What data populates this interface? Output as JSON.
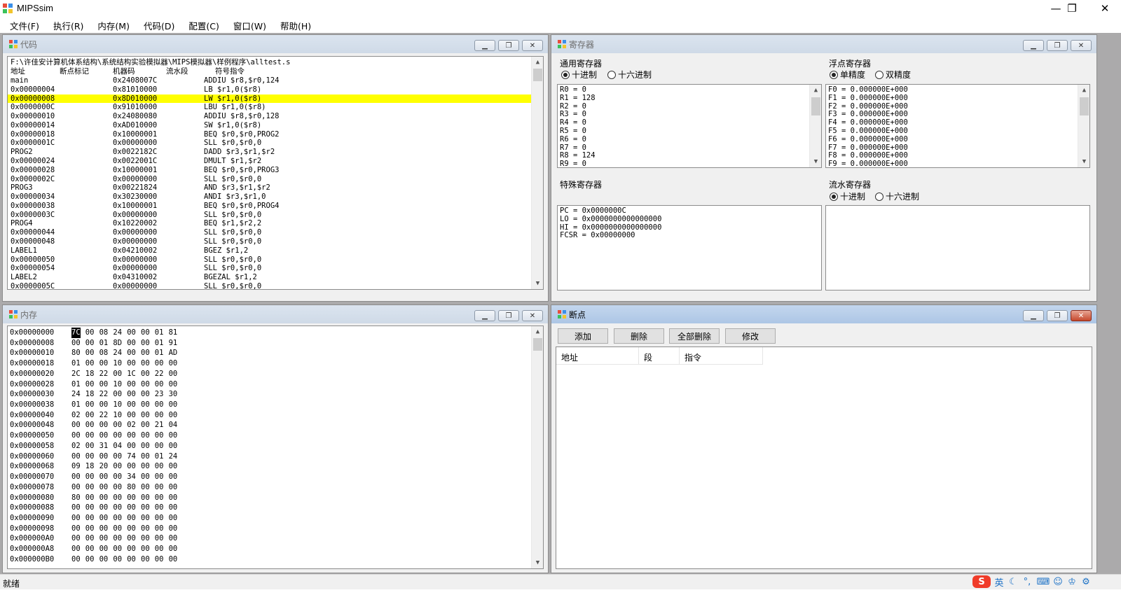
{
  "app": {
    "title": "MIPSsim",
    "min": "—",
    "max": "❐",
    "close": "✕"
  },
  "menu": [
    "文件(F)",
    "执行(R)",
    "内存(M)",
    "代码(D)",
    "配置(C)",
    "窗口(W)",
    "帮助(H)"
  ],
  "code_panel": {
    "title": "代码",
    "path": "F:\\许佳安计算机体系结构\\系统结构实验模拟器\\MIPS模拟器\\样例程序\\alltest.s",
    "headers": {
      "addr": "地址",
      "bp": "断点标记",
      "code": "机器码",
      "stage": "流水段",
      "inst": "符号指令"
    },
    "highlight_color": "#ffff00",
    "rows": [
      {
        "addr": "main",
        "code": "0x2408007C",
        "inst": "ADDIU $r8,$r0,124"
      },
      {
        "addr": "0x00000004",
        "code": "0x81010000",
        "inst": "LB $r1,0($r8)"
      },
      {
        "addr": "0x00000008",
        "code": "0x8D010000",
        "inst": "LW $r1,0($r8)",
        "highlight": true
      },
      {
        "addr": "0x0000000C",
        "code": "0x91010000",
        "inst": "LBU $r1,0($r8)"
      },
      {
        "addr": "0x00000010",
        "code": "0x24080080",
        "inst": "ADDIU $r8,$r0,128"
      },
      {
        "addr": "0x00000014",
        "code": "0xAD010000",
        "inst": "SW $r1,0($r8)"
      },
      {
        "addr": "0x00000018",
        "code": "0x10000001",
        "inst": "BEQ $r0,$r0,PROG2"
      },
      {
        "addr": "0x0000001C",
        "code": "0x00000000",
        "inst": "SLL $r0,$r0,0"
      },
      {
        "addr": "PROG2",
        "code": "0x0022182C",
        "inst": "DADD $r3,$r1,$r2"
      },
      {
        "addr": "0x00000024",
        "code": "0x0022001C",
        "inst": "DMULT $r1,$r2"
      },
      {
        "addr": "0x00000028",
        "code": "0x10000001",
        "inst": "BEQ $r0,$r0,PROG3"
      },
      {
        "addr": "0x0000002C",
        "code": "0x00000000",
        "inst": "SLL $r0,$r0,0"
      },
      {
        "addr": "PROG3",
        "code": "0x00221824",
        "inst": "AND $r3,$r1,$r2"
      },
      {
        "addr": "0x00000034",
        "code": "0x30230000",
        "inst": "ANDI $r3,$r1,0"
      },
      {
        "addr": "0x00000038",
        "code": "0x10000001",
        "inst": "BEQ $r0,$r0,PROG4"
      },
      {
        "addr": "0x0000003C",
        "code": "0x00000000",
        "inst": "SLL $r0,$r0,0"
      },
      {
        "addr": "PROG4",
        "code": "0x10220002",
        "inst": "BEQ $r1,$r2,2"
      },
      {
        "addr": "0x00000044",
        "code": "0x00000000",
        "inst": "SLL $r0,$r0,0"
      },
      {
        "addr": "0x00000048",
        "code": "0x00000000",
        "inst": "SLL $r0,$r0,0"
      },
      {
        "addr": "LABEL1",
        "code": "0x04210002",
        "inst": "BGEZ $r1,2"
      },
      {
        "addr": "0x00000050",
        "code": "0x00000000",
        "inst": "SLL $r0,$r0,0"
      },
      {
        "addr": "0x00000054",
        "code": "0x00000000",
        "inst": "SLL $r0,$r0,0"
      },
      {
        "addr": "LABEL2",
        "code": "0x04310002",
        "inst": "BGEZAL $r1,2"
      },
      {
        "addr": "0x0000005C",
        "code": "0x00000000",
        "inst": "SLL $r0,$r0,0"
      }
    ]
  },
  "registers_panel": {
    "title": "寄存器",
    "general": {
      "label": "通用寄存器",
      "radio_dec": "十进制",
      "radio_hex": "十六进制",
      "values": [
        "R0 = 0",
        "R1 = 128",
        "R2 = 0",
        "R3 = 0",
        "R4 = 0",
        "R5 = 0",
        "R6 = 0",
        "R7 = 0",
        "R8 = 124",
        "R9 = 0"
      ]
    },
    "float": {
      "label": "浮点寄存器",
      "radio_single": "单精度",
      "radio_double": "双精度",
      "values": [
        "F0 = 0.000000E+000",
        "F1 = 0.000000E+000",
        "F2 = 0.000000E+000",
        "F3 = 0.000000E+000",
        "F4 = 0.000000E+000",
        "F5 = 0.000000E+000",
        "F6 = 0.000000E+000",
        "F7 = 0.000000E+000",
        "F8 = 0.000000E+000",
        "F9 = 0.000000E+000"
      ]
    },
    "special": {
      "label": "特殊寄存器",
      "values": [
        "PC = 0x0000000C",
        "LO = 0x0000000000000000",
        "HI = 0x0000000000000000",
        "FCSR = 0x00000000"
      ]
    },
    "pipeline": {
      "label": "流水寄存器",
      "radio_dec": "十进制",
      "radio_hex": "十六进制"
    }
  },
  "memory_panel": {
    "title": "内存",
    "rows": [
      {
        "addr": "0x00000000",
        "bytes": [
          "7C",
          "00",
          "08",
          "24",
          "00",
          "00",
          "01",
          "81"
        ]
      },
      {
        "addr": "0x00000008",
        "bytes": [
          "00",
          "00",
          "01",
          "8D",
          "00",
          "00",
          "01",
          "91"
        ]
      },
      {
        "addr": "0x00000010",
        "bytes": [
          "80",
          "00",
          "08",
          "24",
          "00",
          "00",
          "01",
          "AD"
        ]
      },
      {
        "addr": "0x00000018",
        "bytes": [
          "01",
          "00",
          "00",
          "10",
          "00",
          "00",
          "00",
          "00"
        ]
      },
      {
        "addr": "0x00000020",
        "bytes": [
          "2C",
          "18",
          "22",
          "00",
          "1C",
          "00",
          "22",
          "00"
        ]
      },
      {
        "addr": "0x00000028",
        "bytes": [
          "01",
          "00",
          "00",
          "10",
          "00",
          "00",
          "00",
          "00"
        ]
      },
      {
        "addr": "0x00000030",
        "bytes": [
          "24",
          "18",
          "22",
          "00",
          "00",
          "00",
          "23",
          "30"
        ]
      },
      {
        "addr": "0x00000038",
        "bytes": [
          "01",
          "00",
          "00",
          "10",
          "00",
          "00",
          "00",
          "00"
        ]
      },
      {
        "addr": "0x00000040",
        "bytes": [
          "02",
          "00",
          "22",
          "10",
          "00",
          "00",
          "00",
          "00"
        ]
      },
      {
        "addr": "0x00000048",
        "bytes": [
          "00",
          "00",
          "00",
          "00",
          "02",
          "00",
          "21",
          "04"
        ]
      },
      {
        "addr": "0x00000050",
        "bytes": [
          "00",
          "00",
          "00",
          "00",
          "00",
          "00",
          "00",
          "00"
        ]
      },
      {
        "addr": "0x00000058",
        "bytes": [
          "02",
          "00",
          "31",
          "04",
          "00",
          "00",
          "00",
          "00"
        ]
      },
      {
        "addr": "0x00000060",
        "bytes": [
          "00",
          "00",
          "00",
          "00",
          "74",
          "00",
          "01",
          "24"
        ]
      },
      {
        "addr": "0x00000068",
        "bytes": [
          "09",
          "18",
          "20",
          "00",
          "00",
          "00",
          "00",
          "00"
        ]
      },
      {
        "addr": "0x00000070",
        "bytes": [
          "00",
          "00",
          "00",
          "00",
          "34",
          "00",
          "00",
          "00"
        ]
      },
      {
        "addr": "0x00000078",
        "bytes": [
          "00",
          "00",
          "00",
          "00",
          "80",
          "00",
          "00",
          "00"
        ]
      },
      {
        "addr": "0x00000080",
        "bytes": [
          "80",
          "00",
          "00",
          "00",
          "00",
          "00",
          "00",
          "00"
        ]
      },
      {
        "addr": "0x00000088",
        "bytes": [
          "00",
          "00",
          "00",
          "00",
          "00",
          "00",
          "00",
          "00"
        ]
      },
      {
        "addr": "0x00000090",
        "bytes": [
          "00",
          "00",
          "00",
          "00",
          "00",
          "00",
          "00",
          "00"
        ]
      },
      {
        "addr": "0x00000098",
        "bytes": [
          "00",
          "00",
          "00",
          "00",
          "00",
          "00",
          "00",
          "00"
        ]
      },
      {
        "addr": "0x000000A0",
        "bytes": [
          "00",
          "00",
          "00",
          "00",
          "00",
          "00",
          "00",
          "00"
        ]
      },
      {
        "addr": "0x000000A8",
        "bytes": [
          "00",
          "00",
          "00",
          "00",
          "00",
          "00",
          "00",
          "00"
        ]
      },
      {
        "addr": "0x000000B0",
        "bytes": [
          "00",
          "00",
          "00",
          "00",
          "00",
          "00",
          "00",
          "00"
        ]
      }
    ]
  },
  "breakpoints_panel": {
    "title": "断点",
    "buttons": {
      "add": "添加",
      "delete": "删除",
      "delete_all": "全部删除",
      "modify": "修改"
    },
    "columns": {
      "addr": "地址",
      "seg": "段",
      "inst": "指令"
    }
  },
  "status": {
    "text": "就绪"
  },
  "tray": {
    "ime": "英"
  }
}
